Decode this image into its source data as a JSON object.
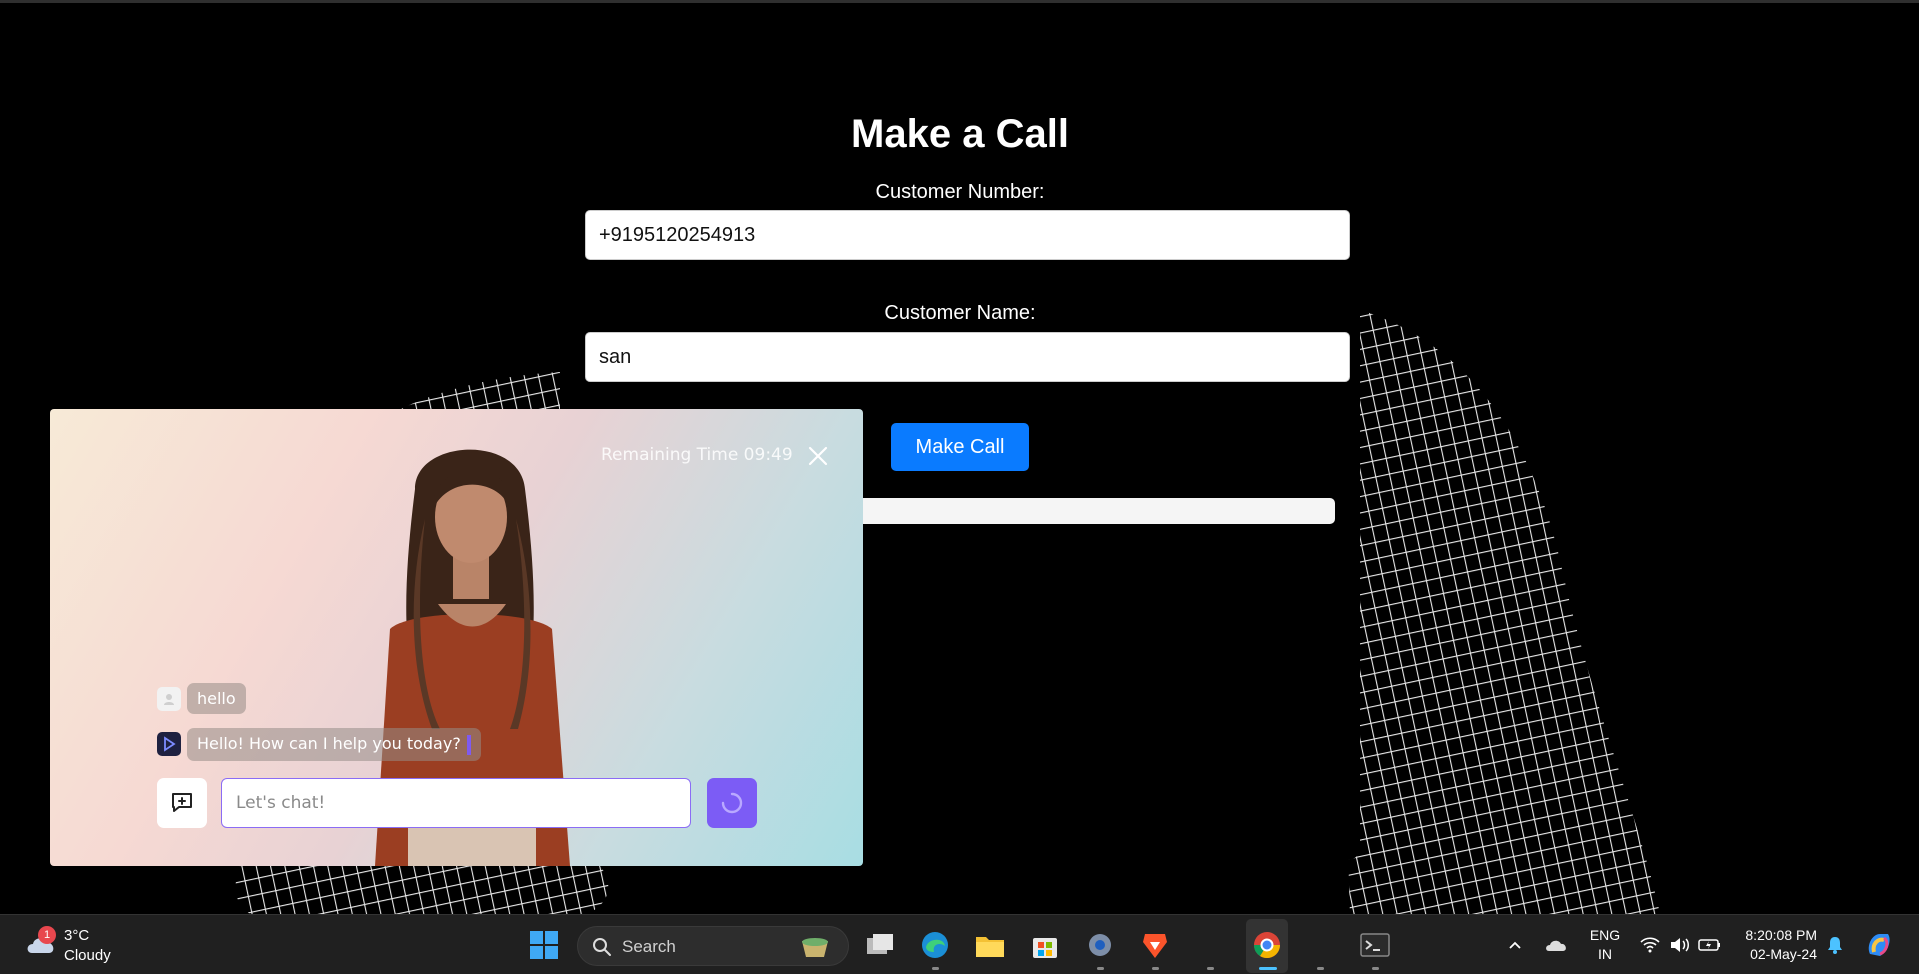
{
  "form": {
    "title": "Make a Call",
    "number_label": "Customer Number:",
    "number_value": "+9195120254913",
    "name_label": "Customer Name:",
    "name_value": "san",
    "submit_label": "Make Call"
  },
  "widget": {
    "remaining_time": "Remaining Time 09:49",
    "messages": [
      {
        "sender": "user",
        "text": "hello"
      },
      {
        "sender": "assistant",
        "text": "Hello! How can I help you today?"
      }
    ],
    "input_placeholder": "Let's chat!",
    "accent_color": "#7c5cf5"
  },
  "taskbar": {
    "weather_temp": "3°C",
    "weather_condition": "Cloudy",
    "weather_badge": "1",
    "search_label": "Search",
    "language_line1": "ENG",
    "language_line2": "IN",
    "time": "8:20:08 PM",
    "date": "02-May-24",
    "apps": [
      "windows-start-icon",
      "search-icon",
      "task-view-icon",
      "edge-icon",
      "file-explorer-icon",
      "microsoft-store-icon",
      "settings-icon",
      "brave-icon",
      "chrome-icon",
      "terminal-icon"
    ]
  },
  "colors": {
    "primary_button": "#0a7bff",
    "background": "#000000",
    "taskbar": "#202020"
  }
}
